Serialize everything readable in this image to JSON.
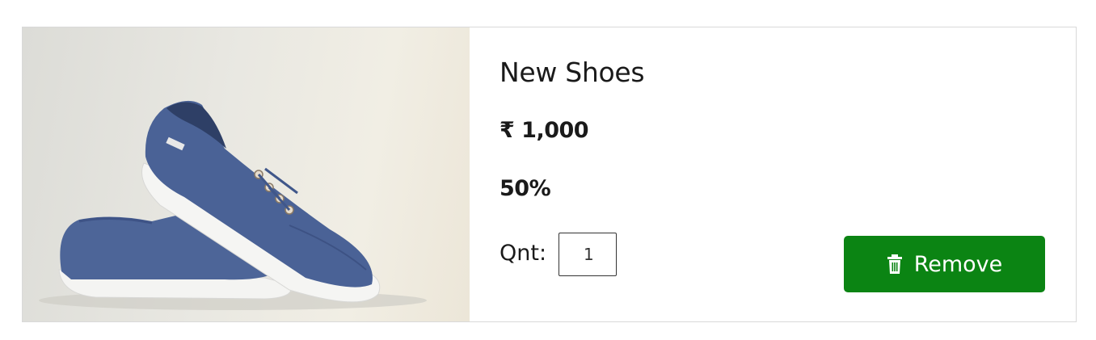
{
  "product": {
    "name": "New Shoes",
    "price": "₹ 1,000",
    "discount": "50%",
    "quantity_label": "Qnt:",
    "quantity_value": "1"
  },
  "actions": {
    "remove_label": "Remove",
    "remove_icon": "trash-icon"
  },
  "colors": {
    "remove_button": "#0b8413",
    "shoe": "#4a6296"
  }
}
